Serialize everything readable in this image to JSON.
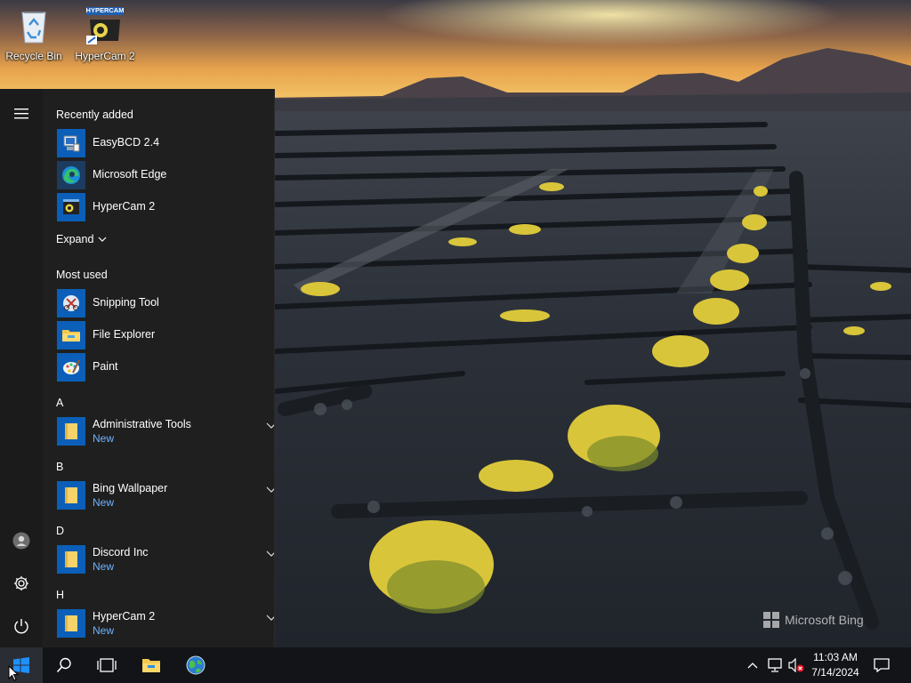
{
  "desktop": {
    "icons": [
      {
        "label": "Recycle Bin",
        "icon": "recycle-bin-icon"
      },
      {
        "label": "HyperCam 2",
        "icon": "hypercam-icon",
        "logo_text": "HYPERCAM"
      }
    ],
    "watermark": "Microsoft Bing"
  },
  "start_menu": {
    "recently_added": {
      "heading": "Recently added",
      "items": [
        {
          "name": "EasyBCD 2.4",
          "icon": "easybcd-icon"
        },
        {
          "name": "Microsoft Edge",
          "icon": "edge-icon"
        },
        {
          "name": "HyperCam 2",
          "icon": "hypercam-icon"
        }
      ],
      "expand_label": "Expand"
    },
    "most_used": {
      "heading": "Most used",
      "items": [
        {
          "name": "Snipping Tool",
          "icon": "snipping-tool-icon"
        },
        {
          "name": "File Explorer",
          "icon": "folder-icon"
        },
        {
          "name": "Paint",
          "icon": "paint-icon"
        }
      ]
    },
    "alphabetical": [
      {
        "letter": "A",
        "name": "Administrative Tools",
        "badge": "New"
      },
      {
        "letter": "B",
        "name": "Bing Wallpaper",
        "badge": "New"
      },
      {
        "letter": "D",
        "name": "Discord Inc",
        "badge": "New"
      },
      {
        "letter": "H",
        "name": "HyperCam 2",
        "badge": "New"
      }
    ]
  },
  "taskbar": {
    "clock_time": "11:03 AM",
    "clock_date": "7/14/2024"
  },
  "colors": {
    "accent": "#0078d7",
    "new_badge": "#6fb3ff",
    "menu_bg": "#1f1f1f",
    "taskbar_bg": "#121417"
  }
}
